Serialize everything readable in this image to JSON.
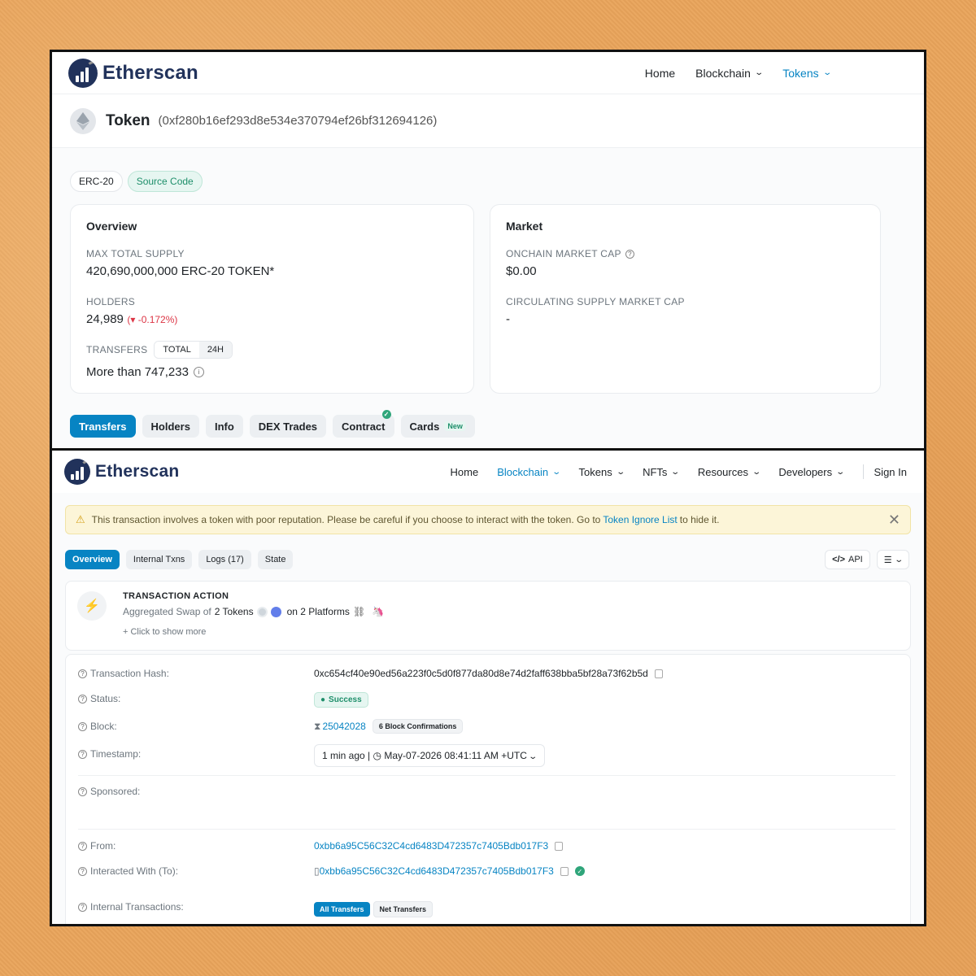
{
  "top": {
    "logo_text": "Etherscan",
    "nav": {
      "home": "Home",
      "blockchain": "Blockchain",
      "tokens": "Tokens"
    },
    "token_title": "Token",
    "token_address": "(0xf280b16ef293d8e534e370794ef26bf312694126)",
    "badges": {
      "standard": "ERC-20",
      "source_code": "Source Code"
    },
    "overview": {
      "title": "Overview",
      "max_supply_label": "MAX TOTAL SUPPLY",
      "max_supply_value": "420,690,000,000 ERC-20 TOKEN*",
      "holders_label": "HOLDERS",
      "holders_value": "24,989",
      "holders_change": "(▾ -0.172%)",
      "transfers_label": "TRANSFERS",
      "transfers_toggle": [
        "TOTAL",
        "24H"
      ],
      "transfers_value": "More than 747,233"
    },
    "market": {
      "title": "Market",
      "onchain_cap_label": "ONCHAIN MARKET CAP",
      "onchain_cap_value": "$0.00",
      "circ_cap_label": "CIRCULATING SUPPLY MARKET CAP",
      "circ_cap_value": "-"
    },
    "tabs": [
      "Transfers",
      "Holders",
      "Info",
      "DEX Trades",
      "Contract",
      "Cards"
    ],
    "new_badge": "New"
  },
  "bottom": {
    "logo_text": "Etherscan",
    "nav": {
      "home": "Home",
      "blockchain": "Blockchain",
      "tokens": "Tokens",
      "nfts": "NFTs",
      "resources": "Resources",
      "developers": "Developers",
      "sign_in": "Sign In"
    },
    "warning": {
      "text": "This transaction involves a token with poor reputation. Please be careful if you choose to interact with the token. Go to",
      "link": "Token Ignore List",
      "suffix": "to hide it."
    },
    "tabs": [
      "Overview",
      "Internal Txns",
      "Logs (17)",
      "State"
    ],
    "api_label": "API",
    "action": {
      "title": "TRANSACTION ACTION",
      "line_prefix": "Aggregated Swap of",
      "line_count": "2 Tokens",
      "platforms": "on 2 Platforms",
      "show_more": "+ Click to show more"
    },
    "details": {
      "hash_label": "Transaction Hash:",
      "hash_value": "0xc654cf40e90ed56a223f0c5d0f877da80d8e74d2faff638bba5bf28a73f62b5d",
      "status_label": "Status:",
      "status_value": "Success",
      "block_label": "Block:",
      "block_value": "25042028",
      "block_conf": "6 Block Confirmations",
      "timestamp_label": "Timestamp:",
      "timestamp_ago": "1 min ago",
      "timestamp_value": "May-07-2026 08:41:11 AM +UTC",
      "sponsored_label": "Sponsored:",
      "from_label": "From:",
      "from_value": "0xbb6a95C56C32C4cd6483D472357c7405Bdb017F3",
      "to_label": "Interacted With (To):",
      "to_value": "0xbb6a95C56C32C4cd6483D472357c7405Bdb017F3",
      "internal_label": "Internal Transactions:",
      "internal_tabs": [
        "All Transfers",
        "Net Transfers"
      ]
    }
  },
  "colors": {
    "brand": "#21325b",
    "accent": "#0784c3",
    "success": "#1f8f6b",
    "danger": "#dc3545",
    "warn_bg": "#fcf5d8",
    "backdrop": "#e9a45b"
  }
}
